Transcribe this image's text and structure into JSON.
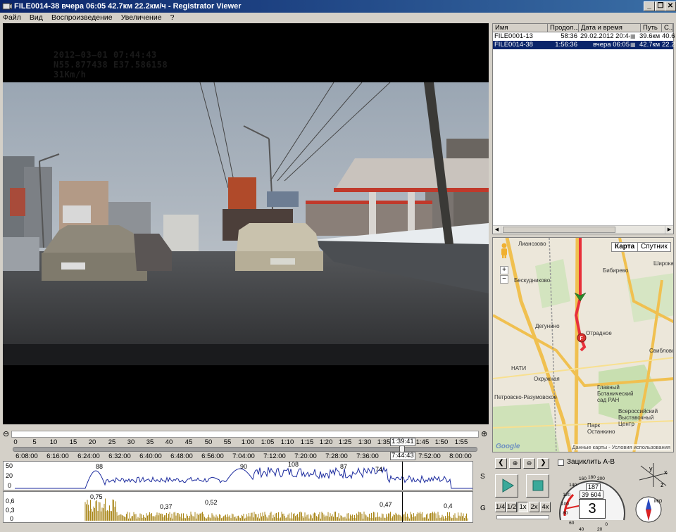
{
  "window": {
    "title": "FILE0014-38    вчера 06:05    42.7км    22.2км/ч - Registrator Viewer",
    "buttons": [
      "_",
      "❐",
      "✕"
    ]
  },
  "menu": [
    "Файл",
    "Вид",
    "Воспроизведение",
    "Увеличение",
    "?"
  ],
  "video": {
    "osd_date": "2012—03—01   07:44:43",
    "osd_coords": "N55.877438   E37.586158",
    "osd_speed": "31Km/h"
  },
  "filelist": {
    "headers": [
      "Имя",
      "Продол...",
      "Дата и время",
      "Путь",
      "С..."
    ],
    "rows": [
      {
        "name": "FILE0001-13",
        "duration": "58:36",
        "datetime": "29.02.2012 20:44",
        "path": "39.6км",
        "extra": "40.6",
        "selected": false
      },
      {
        "name": "FILE0014-38",
        "duration": "1:56:36",
        "datetime": "вчера 06:05",
        "path": "42.7км",
        "extra": "22.2",
        "selected": true
      }
    ]
  },
  "map": {
    "tabs": [
      "Карта",
      "Спутник"
    ],
    "labels": [
      "Лианозово",
      "Бескудниково",
      "Бибирево",
      "Дегунино",
      "Отрадное",
      "НАТИ",
      "Окружная",
      "Петровско-Разумовское",
      "Главный Ботанический сад РАН",
      "Всероссийский Выставочный Центр",
      "Парк Останкино",
      "Свиблово",
      "Широкая"
    ],
    "footer": "Данные карты - Условия использования",
    "logo": "Google"
  },
  "timeline": {
    "top_ticks": [
      "0",
      "5",
      "10",
      "15",
      "20",
      "25",
      "30",
      "35",
      "40",
      "45",
      "50",
      "55",
      "1:00",
      "1:05",
      "1:10",
      "1:15",
      "1:20",
      "1:25",
      "1:30",
      "1:35",
      "1:45",
      "1:50",
      "1:55"
    ],
    "position_label": "1:39:41",
    "bottom_ticks": [
      "6:08:00",
      "6:16:00",
      "6:24:00",
      "6:32:00",
      "6:40:00",
      "6:48:00",
      "6:56:00",
      "7:04:00",
      "7:12:00",
      "7:20:00",
      "7:28:00",
      "7:36:00",
      "7:52:00",
      "8:00:00"
    ],
    "clock_label": "7:44:43",
    "zoom_out": "⊖",
    "zoom_in": "⊕"
  },
  "speed_graph": {
    "axis": [
      "50",
      "20",
      "0"
    ],
    "peaks": [
      "88",
      "90",
      "108",
      "87",
      "74"
    ],
    "label": "S"
  },
  "g_graph": {
    "axis": [
      "0,6",
      "0,3",
      "0"
    ],
    "peaks": [
      "0,75",
      "0,37",
      "0,52",
      "0,47",
      "0,4"
    ],
    "label": "G"
  },
  "controls": {
    "loop_label": "Зациклить А-В",
    "speed_buttons": [
      "1/4",
      "1/2",
      "1x",
      "2x",
      "4x"
    ],
    "odometer": "39 604",
    "trip": "187",
    "gear": "3",
    "speedo_ticks": [
      "40",
      "60",
      "80",
      "100",
      "120",
      "140",
      "160",
      "180",
      "200",
      "20",
      "0"
    ],
    "axis_letters": [
      "x",
      "y",
      "z"
    ],
    "compass": "MIO"
  }
}
